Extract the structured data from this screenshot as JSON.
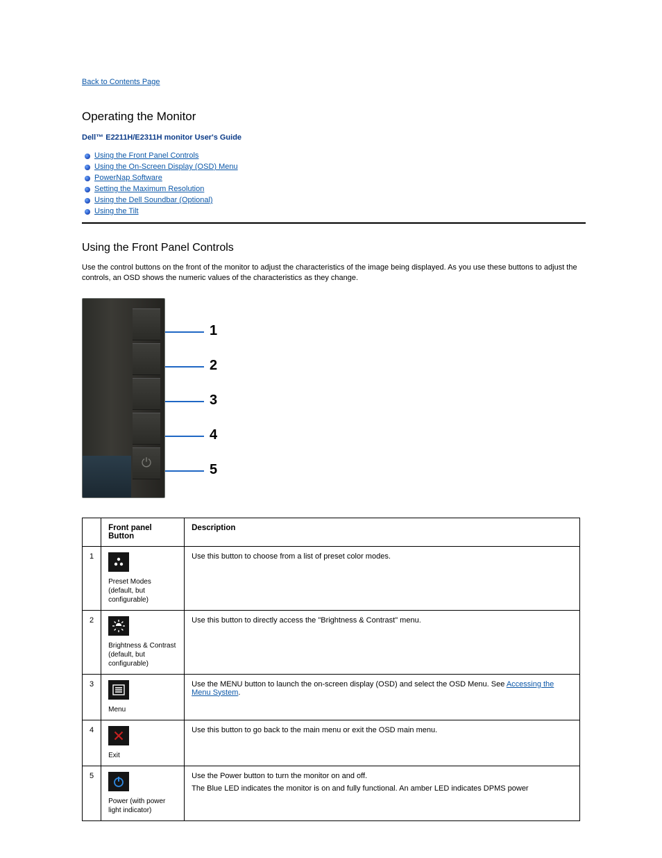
{
  "nav": {
    "back": "Back to Contents Page"
  },
  "header": {
    "title": "Operating the Monitor",
    "subtitle": "Dell™ E2211H/E2311H monitor User's Guide"
  },
  "toc": [
    "Using the Front Panel Controls",
    "Using the On-Screen Display (OSD) Menu",
    "PowerNap Software",
    "Setting the Maximum Resolution",
    "Using the Dell Soundbar (Optional)",
    "Using the Tilt"
  ],
  "section1": {
    "heading": "Using the Front Panel Controls",
    "para": "Use the control buttons on the front of the monitor to adjust the characteristics of the image being displayed. As you use these buttons to adjust the controls, an OSD shows the numeric values of the characteristics as they change."
  },
  "diagram": {
    "labels": [
      "1",
      "2",
      "3",
      "4",
      "5"
    ]
  },
  "table": {
    "headers": [
      "",
      "Front panel Button",
      "Description"
    ],
    "rows": [
      {
        "num": "1",
        "label": "Preset Modes (default, but configurable)",
        "desc": [
          "Use this button to choose from a list of preset color modes."
        ]
      },
      {
        "num": "2",
        "label": "Brightness & Contrast (default, but configurable)",
        "desc": [
          "Use this button to directly access the \"Brightness & Contrast\" menu."
        ]
      },
      {
        "num": "3",
        "label": "Menu",
        "desc_prefix": "Use the MENU button to launch the on-screen display (OSD) and select the OSD Menu. See ",
        "desc_link": "Accessing the Menu System",
        "desc_suffix": "."
      },
      {
        "num": "4",
        "label": "Exit",
        "desc": [
          "Use this button to go back to the main menu or exit the OSD main menu."
        ]
      },
      {
        "num": "5",
        "label": "Power (with power light indicator)",
        "desc": [
          "Use the Power button to turn the monitor on and off.",
          "The Blue LED indicates the monitor is on and fully functional. An amber LED indicates DPMS power"
        ]
      }
    ]
  }
}
